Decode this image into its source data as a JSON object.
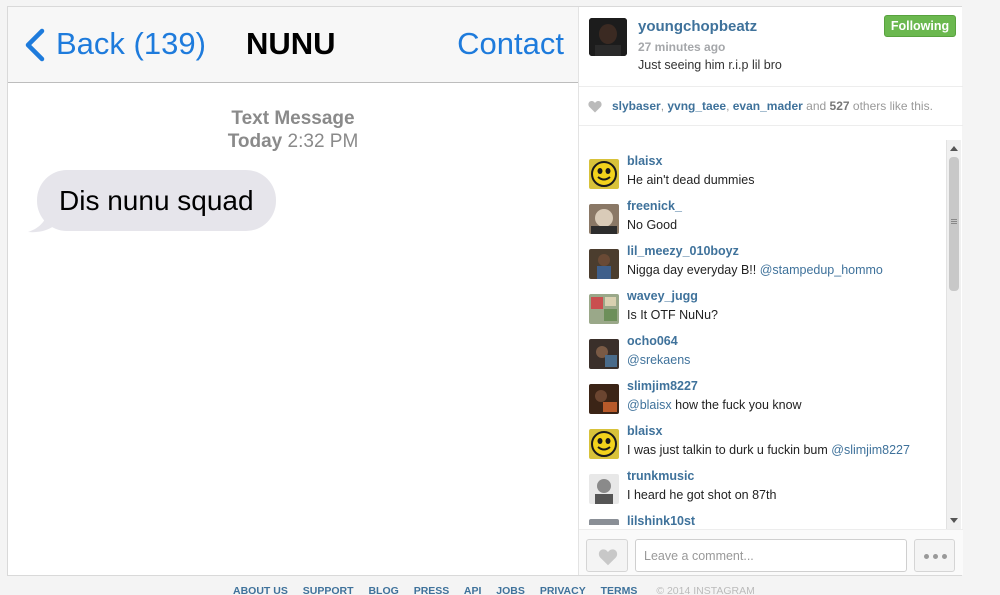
{
  "imessage": {
    "back_label": "Back (139)",
    "title": "NUNU",
    "contact_label": "Contact",
    "timestamp_label": "Text Message",
    "timestamp_day": "Today",
    "timestamp_time": "2:32 PM",
    "message": "Dis nunu squad"
  },
  "post": {
    "username": "youngchopbeatz",
    "time": "27 minutes ago",
    "caption": "Just seeing him r.i.p lil bro",
    "follow_label": "Following",
    "likes": {
      "user1": "slybaser",
      "user2": "yvng_taee",
      "user3": "evan_mader",
      "and": "and",
      "count": "527",
      "suffix": "others like this."
    }
  },
  "comments": [
    {
      "user": "blaisx",
      "pre": "He ain't dead dummies",
      "mention": "",
      "post": ""
    },
    {
      "user": "freenick_",
      "pre": "No Good",
      "mention": "",
      "post": ""
    },
    {
      "user": "lil_meezy_010boyz",
      "pre": "Nigga day everyday B!! ",
      "mention": "@stampedup_hommo",
      "post": ""
    },
    {
      "user": "wavey_jugg",
      "pre": "Is It OTF NuNu?",
      "mention": "",
      "post": ""
    },
    {
      "user": "ocho064",
      "pre": "",
      "mention": "@srekaens",
      "post": ""
    },
    {
      "user": "slimjim8227",
      "pre": "",
      "mention": "@blaisx",
      "post": " how the fuck you know"
    },
    {
      "user": "blaisx",
      "pre": "I was just talkin to durk u fuckin bum ",
      "mention": "@slimjim8227",
      "post": ""
    },
    {
      "user": "trunkmusic",
      "pre": "I heard he got shot on 87th",
      "mention": "",
      "post": ""
    },
    {
      "user": "lilshink10st",
      "pre": "",
      "mention": "",
      "post": ""
    }
  ],
  "comment_box": {
    "placeholder": "Leave a comment..."
  },
  "footer": {
    "about": "ABOUT US",
    "support": "SUPPORT",
    "blog": "BLOG",
    "press": "PRESS",
    "api": "API",
    "jobs": "JOBS",
    "privacy": "PRIVACY",
    "terms": "TERMS",
    "copyright": "© 2014 INSTAGRAM"
  },
  "colors": {
    "ios_blue": "#1e7bdc",
    "ig_link": "#3f729b",
    "follow_green": "#6bb84f",
    "bubble_gray": "#e6e5eb"
  },
  "icons": [
    "back-chevron-icon",
    "heart-icon",
    "more-dots-icon",
    "scroll-up-icon",
    "scroll-down-icon"
  ]
}
